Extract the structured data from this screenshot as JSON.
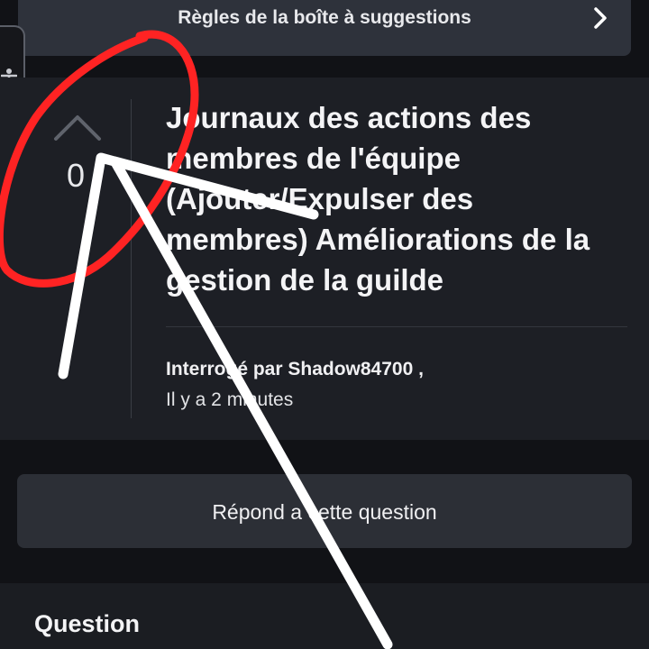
{
  "rules_bar": {
    "label": "Règles de la boîte à suggestions",
    "chevron_icon": "chevron-right-icon"
  },
  "accessibility": {
    "icon": "accessibility-person-icon"
  },
  "question": {
    "vote_count": "0",
    "upvote_icon": "chevron-up-icon",
    "title": "Journaux des actions des membres de l'équipe (Ajouter/Expulser des membres) Améliorations de la gestion de la guilde",
    "author_line": "Interrogé par Shadow84700 ,",
    "time": "Il y a 2 minutes"
  },
  "answer_button": {
    "label": "Répond a cette question"
  },
  "section": {
    "heading": "Question"
  },
  "colors": {
    "background": "#111216",
    "card": "#1d1f25",
    "bar": "#2e323b",
    "button": "#2c2f36",
    "annotation_red": "#ff2323",
    "annotation_white": "#ffffff"
  }
}
